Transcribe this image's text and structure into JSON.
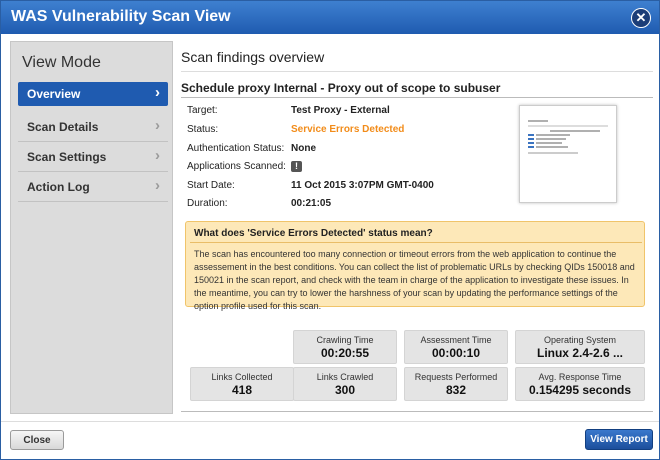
{
  "window": {
    "title": "WAS Vulnerability Scan View"
  },
  "sidebar": {
    "heading": "View Mode",
    "items": [
      {
        "label": "Overview",
        "active": true
      },
      {
        "label": "Scan Details",
        "active": false
      },
      {
        "label": "Scan Settings",
        "active": false
      },
      {
        "label": "Action Log",
        "active": false
      }
    ]
  },
  "main": {
    "section_title": "Scan findings overview",
    "scan_name": "Schedule proxy Internal - Proxy out of scope to subuser",
    "details": [
      {
        "label": "Target:",
        "value": "Test Proxy - External"
      },
      {
        "label": "Status:",
        "value": "Service Errors Detected"
      },
      {
        "label": "Authentication Status:",
        "value": "None"
      },
      {
        "label": "Applications Scanned:",
        "value": ""
      },
      {
        "label": "Start Date:",
        "value": "11 Oct 2015 3:07PM GMT-0400"
      },
      {
        "label": "Duration:",
        "value": "00:21:05"
      }
    ],
    "info": {
      "question": "What does 'Service Errors Detected' status mean?",
      "message": "The scan has encountered too many connection or timeout errors from the web application to continue the assessement in the best conditions. You can collect the list of problematic URLs by checking QIDs 150018 and 150021 in the scan report, and check with the team in charge of the application to investigate these issues. In the meantime, you can try to lower the harshness of your scan by updating the performance settings of the option profile used for this scan."
    },
    "stats": [
      {
        "label": "Crawling Time",
        "value": "00:20:55"
      },
      {
        "label": "Assessment Time",
        "value": "00:00:10"
      },
      {
        "label": "Operating System",
        "value": "Linux 2.4-2.6 ..."
      },
      {
        "label": "Links Collected",
        "value": "418"
      },
      {
        "label": "Links Crawled",
        "value": "300"
      },
      {
        "label": "Requests Performed",
        "value": "832"
      },
      {
        "label": "Avg. Response Time",
        "value": "0.154295 seconds"
      }
    ]
  },
  "footer": {
    "close_label": "Close",
    "view_report_label": "View Report"
  },
  "icons": {
    "close": "close-icon",
    "chevron": "chevron-right-icon",
    "warning": "warning-icon"
  },
  "colors": {
    "title_bar": "#1f5bb0",
    "status_error": "#f28c1a",
    "info_bg": "#fde8b8"
  }
}
